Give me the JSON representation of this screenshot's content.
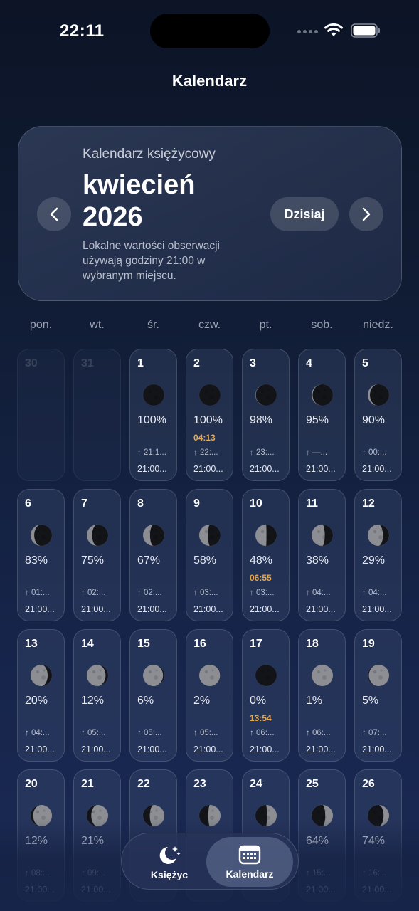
{
  "status": {
    "time": "22:11"
  },
  "header": {
    "title": "Kalendarz"
  },
  "hero": {
    "subtitle": "Kalendarz księżycowy",
    "month": "kwiecień",
    "year": "2026",
    "note": "Lokalne wartości obserwacji używają godziny 21:00 w wybranym miejscu.",
    "today_label": "Dzisiaj"
  },
  "weekdays": [
    "pon.",
    "wt.",
    "śr.",
    "czw.",
    "pt.",
    "sob.",
    "niedz."
  ],
  "days": [
    {
      "num": "30",
      "empty": true
    },
    {
      "num": "31",
      "empty": true
    },
    {
      "num": "1",
      "illum": 1.0,
      "pct": "100%",
      "waxing": false,
      "rise": "↑ 21:1...",
      "obs": "21:00..."
    },
    {
      "num": "2",
      "illum": 1.0,
      "pct": "100%",
      "waxing": false,
      "event": "04:13",
      "rise": "↑ 22:...",
      "obs": "21:00..."
    },
    {
      "num": "3",
      "illum": 0.98,
      "pct": "98%",
      "waxing": false,
      "rise": "↑ 23:...",
      "obs": "21:00..."
    },
    {
      "num": "4",
      "illum": 0.95,
      "pct": "95%",
      "waxing": false,
      "rise": "↑ —...",
      "obs": "21:00..."
    },
    {
      "num": "5",
      "illum": 0.9,
      "pct": "90%",
      "waxing": false,
      "rise": "↑ 00:...",
      "obs": "21:00..."
    },
    {
      "num": "6",
      "illum": 0.83,
      "pct": "83%",
      "waxing": false,
      "rise": "↑ 01:...",
      "obs": "21:00..."
    },
    {
      "num": "7",
      "illum": 0.75,
      "pct": "75%",
      "waxing": false,
      "rise": "↑ 02:...",
      "obs": "21:00..."
    },
    {
      "num": "8",
      "illum": 0.67,
      "pct": "67%",
      "waxing": false,
      "rise": "↑ 02:...",
      "obs": "21:00..."
    },
    {
      "num": "9",
      "illum": 0.58,
      "pct": "58%",
      "waxing": false,
      "rise": "↑ 03:...",
      "obs": "21:00..."
    },
    {
      "num": "10",
      "illum": 0.48,
      "pct": "48%",
      "waxing": false,
      "event": "06:55",
      "rise": "↑ 03:...",
      "obs": "21:00..."
    },
    {
      "num": "11",
      "illum": 0.38,
      "pct": "38%",
      "waxing": false,
      "rise": "↑ 04:...",
      "obs": "21:00..."
    },
    {
      "num": "12",
      "illum": 0.29,
      "pct": "29%",
      "waxing": false,
      "rise": "↑ 04:...",
      "obs": "21:00..."
    },
    {
      "num": "13",
      "illum": 0.2,
      "pct": "20%",
      "waxing": false,
      "rise": "↑ 04:...",
      "obs": "21:00..."
    },
    {
      "num": "14",
      "illum": 0.12,
      "pct": "12%",
      "waxing": false,
      "rise": "↑ 05:...",
      "obs": "21:00..."
    },
    {
      "num": "15",
      "illum": 0.06,
      "pct": "6%",
      "waxing": false,
      "rise": "↑ 05:...",
      "obs": "21:00..."
    },
    {
      "num": "16",
      "illum": 0.02,
      "pct": "2%",
      "waxing": false,
      "rise": "↑ 05:...",
      "obs": "21:00..."
    },
    {
      "num": "17",
      "illum": 0.0,
      "pct": "0%",
      "waxing": true,
      "event": "13:54",
      "rise": "↑ 06:...",
      "obs": "21:00..."
    },
    {
      "num": "18",
      "illum": 0.01,
      "pct": "1%",
      "waxing": true,
      "rise": "↑ 06:...",
      "obs": "21:00..."
    },
    {
      "num": "19",
      "illum": 0.05,
      "pct": "5%",
      "waxing": true,
      "rise": "↑ 07:...",
      "obs": "21:00..."
    },
    {
      "num": "20",
      "illum": 0.12,
      "pct": "12%",
      "waxing": true,
      "rise": "↑ 08:...",
      "obs": "21:00..."
    },
    {
      "num": "21",
      "illum": 0.21,
      "pct": "21%",
      "waxing": true,
      "rise": "↑ 09:...",
      "obs": "21:00..."
    },
    {
      "num": "22",
      "illum": 0.32,
      "pct": "",
      "waxing": true,
      "rise": "",
      "obs": ""
    },
    {
      "num": "23",
      "illum": 0.43,
      "pct": "",
      "waxing": true,
      "rise": "",
      "obs": ""
    },
    {
      "num": "24",
      "illum": 0.54,
      "pct": "",
      "waxing": true,
      "rise": "",
      "obs": ""
    },
    {
      "num": "25",
      "illum": 0.64,
      "pct": "64%",
      "waxing": true,
      "rise": "↑ 15:...",
      "obs": "21:00..."
    },
    {
      "num": "26",
      "illum": 0.74,
      "pct": "74%",
      "waxing": true,
      "rise": "↑ 16:...",
      "obs": "21:00..."
    }
  ],
  "tabbar": {
    "tabs": [
      {
        "label": "Księżyc",
        "icon": "moon-stars-icon",
        "selected": false
      },
      {
        "label": "Kalendarz",
        "icon": "calendar-icon",
        "selected": true
      }
    ]
  },
  "colors": {
    "accent_event": "#e6a84a",
    "moon_lit": "#8c8e93",
    "moon_dark": "#131418"
  }
}
